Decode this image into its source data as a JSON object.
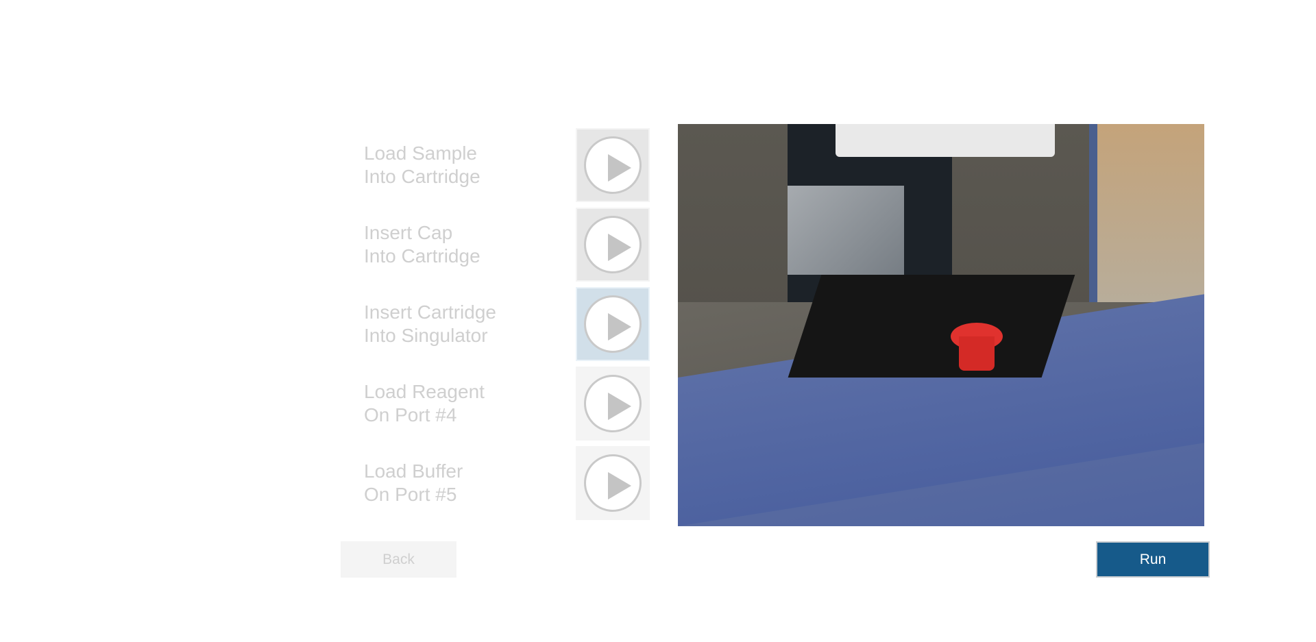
{
  "steps": [
    {
      "line1": "Load Sample",
      "line2": "Into Cartridge",
      "state": "enabled"
    },
    {
      "line1": "Insert Cap",
      "line2": "Into Cartridge",
      "state": "enabled"
    },
    {
      "line1": "Insert Cartridge",
      "line2": "Into Singulator",
      "state": "active"
    },
    {
      "line1": "Load Reagent",
      "line2": "On Port #4",
      "state": "disabled"
    },
    {
      "line1": "Load Buffer",
      "line2": "On Port #5",
      "state": "disabled"
    }
  ],
  "icons": {
    "play": "play-icon"
  },
  "video": {
    "description_icon": "instrument-video"
  },
  "buttons": {
    "back": "Back",
    "run": "Run"
  },
  "colors": {
    "run_button": "#165a8a",
    "active_step": "#d1dfe9",
    "label_disabled": "#cfcfcf"
  }
}
